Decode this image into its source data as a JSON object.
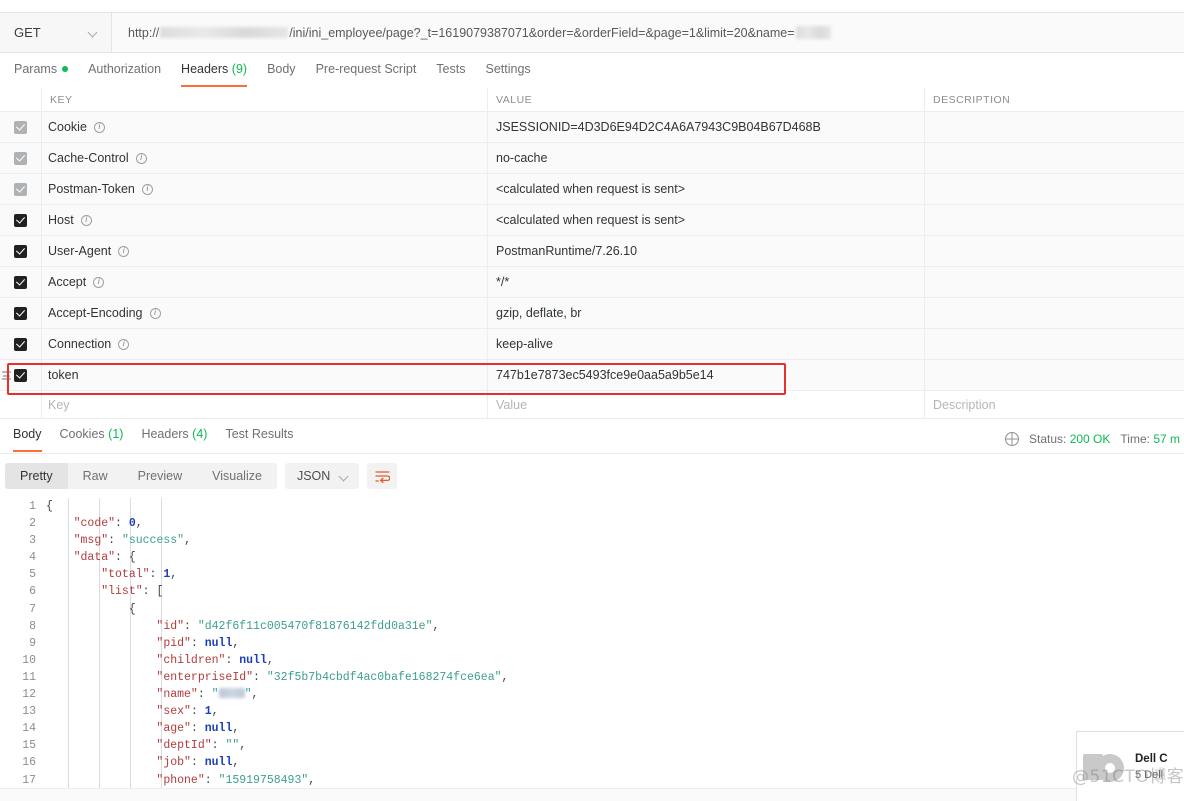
{
  "request": {
    "method": "GET",
    "method_caret_icon": "chevron-down-icon",
    "url_prefix": "http://",
    "url_host_redacted": true,
    "url_suffix": "/ini/ini_employee/page?_t=1619079387071&order=&orderField=&page=1&limit=20&name=",
    "url_name_value_redacted": true,
    "tabs": [
      {
        "label": "Params",
        "badge": "",
        "dot": true,
        "active": false
      },
      {
        "label": "Authorization",
        "badge": "",
        "dot": false,
        "active": false
      },
      {
        "label": "Headers",
        "badge": "(9)",
        "dot": false,
        "active": true
      },
      {
        "label": "Body",
        "badge": "",
        "dot": false,
        "active": false
      },
      {
        "label": "Pre-request Script",
        "badge": "",
        "dot": false,
        "active": false
      },
      {
        "label": "Tests",
        "badge": "",
        "dot": false,
        "active": false
      },
      {
        "label": "Settings",
        "badge": "",
        "dot": false,
        "active": false
      }
    ]
  },
  "headers_table": {
    "columns": {
      "key": "KEY",
      "value": "VALUE",
      "description": "DESCRIPTION"
    },
    "rows": [
      {
        "checked": true,
        "dim": true,
        "key": "Cookie",
        "info": true,
        "value": "JSESSIONID=4D3D6E94D2C4A6A7943C9B04B67D468B",
        "description": ""
      },
      {
        "checked": true,
        "dim": true,
        "key": "Cache-Control",
        "info": true,
        "value": "no-cache",
        "description": ""
      },
      {
        "checked": true,
        "dim": true,
        "key": "Postman-Token",
        "info": true,
        "value": "<calculated when request is sent>",
        "description": ""
      },
      {
        "checked": true,
        "dim": false,
        "key": "Host",
        "info": true,
        "value": "<calculated when request is sent>",
        "description": ""
      },
      {
        "checked": true,
        "dim": false,
        "key": "User-Agent",
        "info": true,
        "value": "PostmanRuntime/7.26.10",
        "description": ""
      },
      {
        "checked": true,
        "dim": false,
        "key": "Accept",
        "info": true,
        "value": "*/*",
        "description": ""
      },
      {
        "checked": true,
        "dim": false,
        "key": "Accept-Encoding",
        "info": true,
        "value": "gzip, deflate, br",
        "description": ""
      },
      {
        "checked": true,
        "dim": false,
        "key": "Connection",
        "info": true,
        "value": "keep-alive",
        "description": ""
      },
      {
        "checked": true,
        "dim": false,
        "key": "token",
        "info": false,
        "value": "747b1e7873ec5493fce9e0aa5a9b5e14",
        "description": "",
        "highlighted": true,
        "draggable": true
      }
    ],
    "placeholder": {
      "key": "Key",
      "value": "Value",
      "description": "Description"
    },
    "highlight_color": "#e8302a"
  },
  "response": {
    "tabs": [
      {
        "label": "Body",
        "badge": "",
        "active": true
      },
      {
        "label": "Cookies",
        "badge": "(1)",
        "active": false
      },
      {
        "label": "Headers",
        "badge": "(4)",
        "active": false
      },
      {
        "label": "Test Results",
        "badge": "",
        "active": false
      }
    ],
    "globe_icon": "globe-icon",
    "status_label": "Status:",
    "status_value": "200 OK",
    "time_label": "Time:",
    "time_value": "57 m",
    "view_modes": [
      {
        "label": "Pretty",
        "active": true
      },
      {
        "label": "Raw",
        "active": false
      },
      {
        "label": "Preview",
        "active": false
      },
      {
        "label": "Visualize",
        "active": false
      }
    ],
    "format": "JSON",
    "format_caret_icon": "chevron-down-icon",
    "wrap_icon": "wrap-lines-icon"
  },
  "body_json": {
    "lines": [
      {
        "n": 1,
        "indent": 0,
        "html": "<span class=\"p\">{</span>"
      },
      {
        "n": 2,
        "indent": 1,
        "html": "<span class=\"k\">\"code\"</span><span class=\"p\">: </span><span class=\"n\">0</span><span class=\"p\">,</span>"
      },
      {
        "n": 3,
        "indent": 1,
        "html": "<span class=\"k\">\"msg\"</span><span class=\"p\">: </span><span class=\"s\">\"success\"</span><span class=\"p\">,</span>"
      },
      {
        "n": 4,
        "indent": 1,
        "html": "<span class=\"k\">\"data\"</span><span class=\"p\">: {</span>"
      },
      {
        "n": 5,
        "indent": 2,
        "html": "<span class=\"k\">\"total\"</span><span class=\"p\">: </span><span class=\"n\">1</span><span class=\"p\">,</span>"
      },
      {
        "n": 6,
        "indent": 2,
        "html": "<span class=\"k\">\"list\"</span><span class=\"p\">: [</span>"
      },
      {
        "n": 7,
        "indent": 3,
        "html": "<span class=\"p\">{</span>"
      },
      {
        "n": 8,
        "indent": 4,
        "html": "<span class=\"k\">\"id\"</span><span class=\"p\">: </span><span class=\"s\">\"d42f6f11c005470f81876142fdd0a31e\"</span><span class=\"p\">,</span>"
      },
      {
        "n": 9,
        "indent": 4,
        "html": "<span class=\"k\">\"pid\"</span><span class=\"p\">: </span><span class=\"n\">null</span><span class=\"p\">,</span>"
      },
      {
        "n": 10,
        "indent": 4,
        "html": "<span class=\"k\">\"children\"</span><span class=\"p\">: </span><span class=\"n\">null</span><span class=\"p\">,</span>"
      },
      {
        "n": 11,
        "indent": 4,
        "html": "<span class=\"k\">\"enterpriseId\"</span><span class=\"p\">: </span><span class=\"s\">\"32f5b7b4cbdf4ac0bafe168274fce6ea\"</span><span class=\"p\">,</span>"
      },
      {
        "n": 12,
        "indent": 4,
        "html": "<span class=\"k\">\"name\"</span><span class=\"p\">: </span><span class=\"s\">\"</span><span class=\"blurname\"></span><span class=\"s\">\"</span><span class=\"p\">,</span>"
      },
      {
        "n": 13,
        "indent": 4,
        "html": "<span class=\"k\">\"sex\"</span><span class=\"p\">: </span><span class=\"n\">1</span><span class=\"p\">,</span>"
      },
      {
        "n": 14,
        "indent": 4,
        "html": "<span class=\"k\">\"age\"</span><span class=\"p\">: </span><span class=\"n\">null</span><span class=\"p\">,</span>"
      },
      {
        "n": 15,
        "indent": 4,
        "html": "<span class=\"k\">\"deptId\"</span><span class=\"p\">: </span><span class=\"s\">\"\"</span><span class=\"p\">,</span>"
      },
      {
        "n": 16,
        "indent": 4,
        "html": "<span class=\"k\">\"job\"</span><span class=\"p\">: </span><span class=\"n\">null</span><span class=\"p\">,</span>"
      },
      {
        "n": 17,
        "indent": 4,
        "html": "<span class=\"k\">\"phone\"</span><span class=\"p\">: </span><span class=\"s\">\"15919758493\"</span><span class=\"p\">,</span>"
      }
    ]
  },
  "ad": {
    "title": "Dell C",
    "subtitle": "5 Dell",
    "watermark": "@51CTO博客"
  }
}
